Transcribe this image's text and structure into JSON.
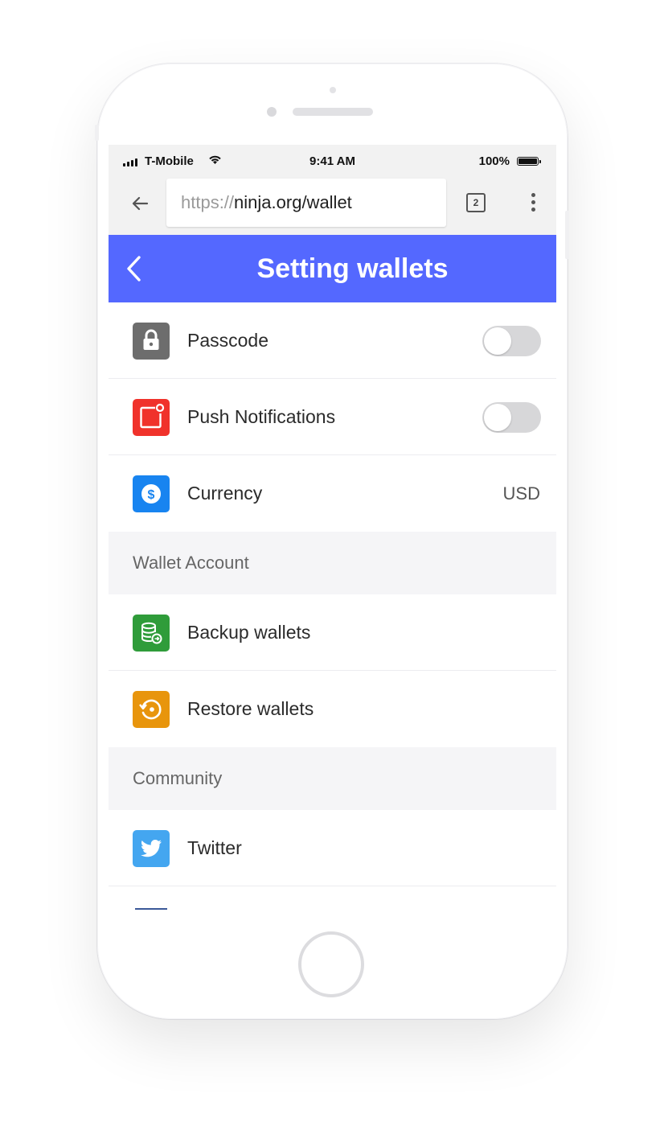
{
  "status_bar": {
    "carrier": "T-Mobile",
    "time": "9:41 AM",
    "battery": "100%"
  },
  "browser": {
    "url_scheme": "https://",
    "url_host": "ninja.org/wallet",
    "tab_count": "2"
  },
  "header": {
    "title": "Setting wallets"
  },
  "settings": {
    "passcode": {
      "label": "Passcode",
      "icon": "lock-icon",
      "icon_color": "#6d6d6d",
      "enabled": false
    },
    "push": {
      "label": "Push Notifications",
      "icon": "notification-icon",
      "icon_color": "#f0322b",
      "enabled": false
    },
    "currency": {
      "label": "Currency",
      "value": "USD",
      "icon": "dollar-icon",
      "icon_color": "#1884f0"
    }
  },
  "wallet_account": {
    "title": "Wallet Account",
    "backup": {
      "label": "Backup wallets",
      "icon": "database-icon",
      "icon_color": "#2f9c3a"
    },
    "restore": {
      "label": "Restore wallets",
      "icon": "restore-icon",
      "icon_color": "#e8950c"
    }
  },
  "community": {
    "title": "Community",
    "twitter": {
      "label": "Twitter",
      "icon": "twitter-icon",
      "icon_color": "#44a6f0"
    }
  },
  "colors": {
    "accent": "#5468ff",
    "toggle_off": "#d7d7d9"
  }
}
